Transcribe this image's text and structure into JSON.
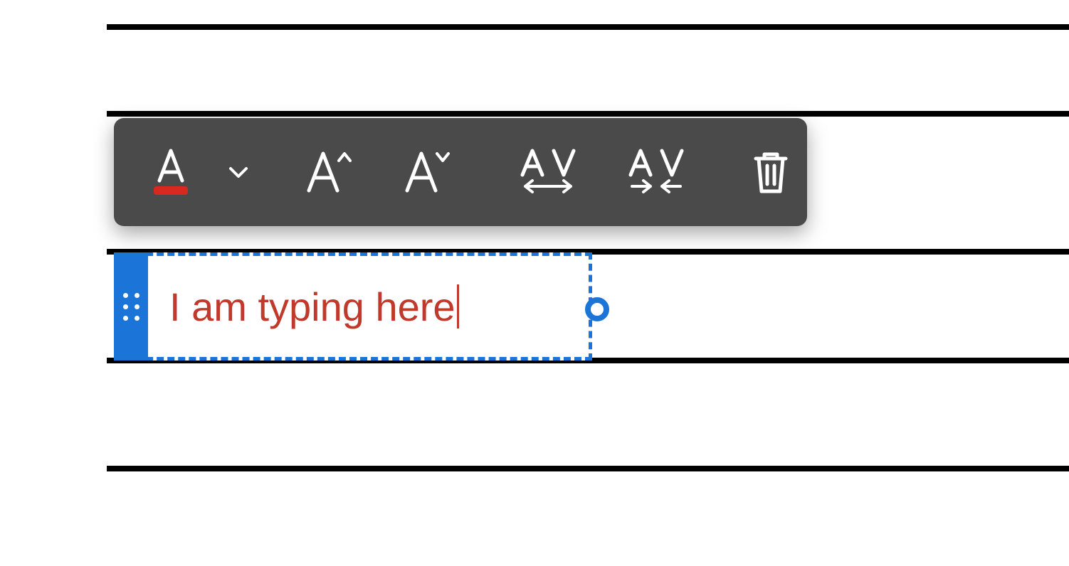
{
  "colors": {
    "toolbar_bg": "#4a4a4a",
    "selection": "#1b74d8",
    "text_color": "#c0392b",
    "font_color_indicator": "#d7291f"
  },
  "textbox": {
    "content": "I am typing here"
  },
  "toolbar": {
    "items": [
      {
        "name": "font-color",
        "icon": "font-color-icon"
      },
      {
        "name": "font-color-dropdown",
        "icon": "chevron-down-icon"
      },
      {
        "sep": true
      },
      {
        "name": "increase-font-size",
        "icon": "font-increase-icon"
      },
      {
        "name": "decrease-font-size",
        "icon": "font-decrease-icon"
      },
      {
        "sep": true
      },
      {
        "name": "increase-spacing",
        "icon": "spacing-increase-icon"
      },
      {
        "name": "decrease-spacing",
        "icon": "spacing-decrease-icon"
      },
      {
        "sep": true
      },
      {
        "name": "delete",
        "icon": "trash-icon"
      }
    ]
  }
}
